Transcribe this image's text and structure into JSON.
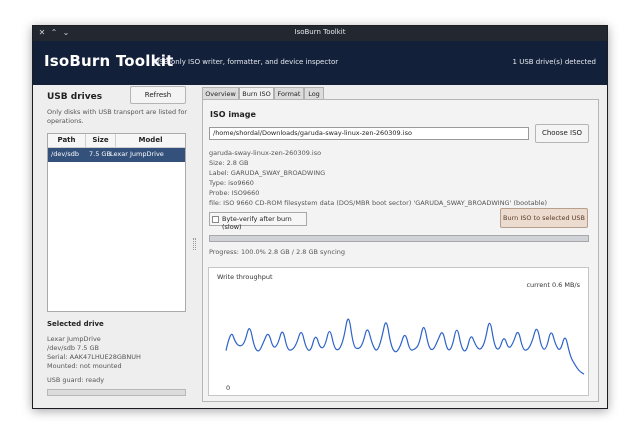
{
  "window": {
    "title": "IsoBurn Toolkit",
    "controls": [
      "✕",
      "⌃",
      "⌄"
    ]
  },
  "header": {
    "app_title": "IsoBurn Toolkit",
    "subtitle": "USB-only ISO writer, formatter, and device inspector",
    "drive_status": "1 USB drive(s) detected"
  },
  "left": {
    "heading": "USB drives",
    "refresh_label": "Refresh",
    "hint": "Only disks with USB transport are listed for w operations.",
    "table": {
      "columns": [
        "Path",
        "Size",
        "Model"
      ],
      "rows": [
        {
          "path": "/dev/sdb",
          "size": "7.5 GB",
          "model": "Lexar JumpDrive"
        }
      ]
    },
    "selected_heading": "Selected drive",
    "selected_info": [
      "Lexar JumpDrive",
      "/dev/sdb  7.5 GB",
      "Serial: AAK47LHUE28GBNUH",
      "Mounted: not mounted"
    ],
    "guard": "USB guard: ready"
  },
  "tabs": [
    "Overview",
    "Burn ISO",
    "Format",
    "Log"
  ],
  "active_tab": "Burn ISO",
  "burn": {
    "heading": "ISO image",
    "path_value": "/home/shordal/Downloads/garuda-sway-linux-zen-260309.iso",
    "choose_label": "Choose ISO",
    "iso_info": [
      "garuda-sway-linux-zen-260309.iso",
      "Size: 2.8 GB",
      "Label: GARUDA_SWAY_BROADWING",
      "Type: iso9660",
      "Probe: ISO9660",
      "file: ISO 9660 CD-ROM filesystem data (DOS/MBR boot sector) 'GARUDA_SWAY_BROADWING' (bootable)"
    ],
    "verify_label": "Byte-verify after burn (slow)",
    "verify_checked": false,
    "burn_label": "Burn ISO to selected USB",
    "progress_fraction": 1.0,
    "progress_text": "Progress: 100.0%  2.8 GB / 2.8 GB  syncing"
  },
  "chart_data": {
    "type": "line",
    "title": "Write throughput",
    "current_text": "current 0.6 MB/s",
    "ymin_label": "0",
    "color": "#2c62c9",
    "ylim": [
      0,
      9
    ],
    "values": [
      2.8,
      5.0,
      3.6,
      3.2,
      3.6,
      5.6,
      3.1,
      2.6,
      3.7,
      4.8,
      3.0,
      3.4,
      5.2,
      2.9,
      2.8,
      3.5,
      5.1,
      3.0,
      2.7,
      4.6,
      3.0,
      3.2,
      5.3,
      3.0,
      2.8,
      4.0,
      6.8,
      3.3,
      2.9,
      3.4,
      5.4,
      3.5,
      2.6,
      3.9,
      6.3,
      3.3,
      2.5,
      3.2,
      4.8,
      2.8,
      2.9,
      3.4,
      5.8,
      3.1,
      2.8,
      3.9,
      5.0,
      2.7,
      3.1,
      5.5,
      3.0,
      2.6,
      4.6,
      3.3,
      2.8,
      3.7,
      6.3,
      3.2,
      2.8,
      4.4,
      2.9,
      3.6,
      5.1,
      2.9,
      2.8,
      3.7,
      5.5,
      3.0,
      2.9,
      5.1,
      3.3,
      2.7,
      4.6,
      2.3,
      1.4,
      0.7,
      0.4
    ]
  }
}
